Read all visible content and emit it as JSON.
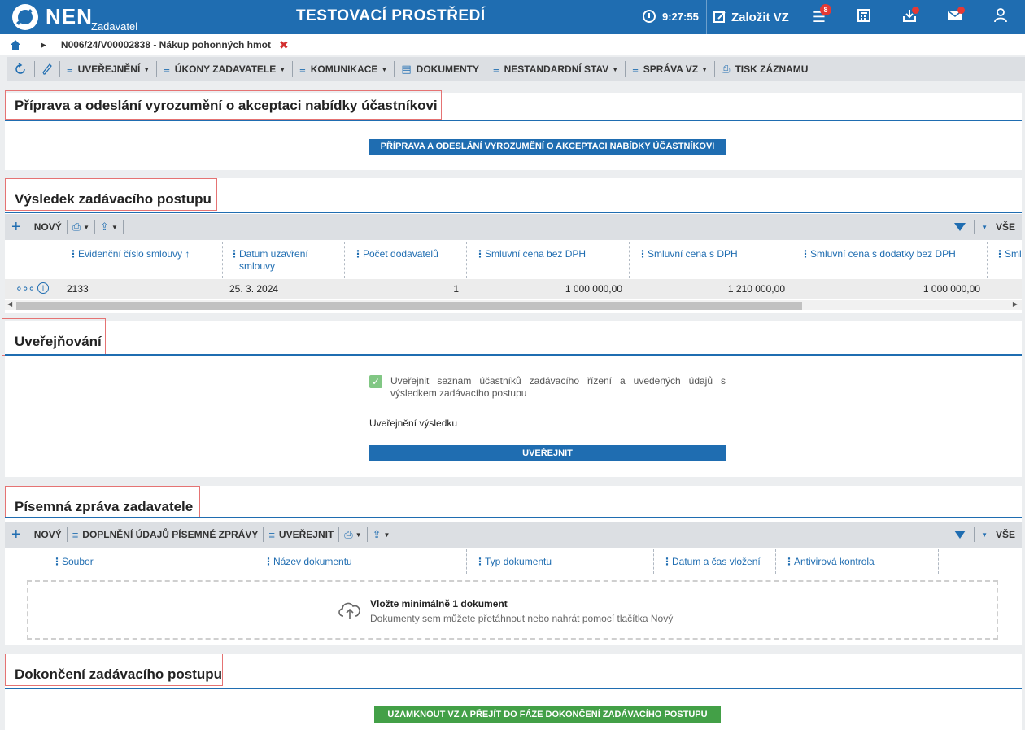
{
  "header": {
    "logo": "NEN",
    "logo_sub": "Zadavatel",
    "env_title": "TESTOVACÍ PROSTŘEDÍ",
    "clock": "9:27:55",
    "create_vz": "Založit VZ",
    "menu_badge": "8"
  },
  "breadcrumb": {
    "text": "N006/24/V00002838 - Nákup pohonných hmot"
  },
  "toolbar": {
    "uverejneni": "UVEŘEJNĚNÍ",
    "ukony": "ÚKONY ZADAVATELE",
    "komunikace": "KOMUNIKACE",
    "dokumenty": "DOKUMENTY",
    "nestandardni": "NESTANDARDNÍ STAV",
    "sprava": "SPRÁVA VZ",
    "tisk": "TISK ZÁZNAMU"
  },
  "section1": {
    "title": "Příprava a odeslání vyrozumění o akceptaci nabídky účastníkovi",
    "button": "PŘÍPRAVA A ODESLÁNÍ VYROZUMĚNÍ O AKCEPTACI NABÍDKY ÚČASTNÍKOVI"
  },
  "section2": {
    "title": "Výsledek zadávacího postupu",
    "new_label": "NOVÝ",
    "all_label": "VŠE",
    "columns": [
      "Evidenční číslo smlouvy ↑",
      "Datum uzavření smlouvy",
      "Počet dodavatelů",
      "Smluvní cena bez DPH",
      "Smluvní cena s DPH",
      "Smluvní cena s dodatky bez DPH",
      "Sml"
    ],
    "row": {
      "ev_cislo": "2133",
      "datum": "25. 3. 2024",
      "pocet": "1",
      "cena_bez": "1 000 000,00",
      "cena_s": "1 210 000,00",
      "cena_dodatky": "1 000 000,00"
    }
  },
  "section3": {
    "title": "Uveřejňování",
    "checkbox_label": "Uveřejnit seznam účastníků zadávacího řízení a uvedených údajů s výsledkem zadávacího postupu",
    "checkbox_checked": true,
    "result_label": "Uveřejnění výsledku",
    "button": "UVEŘEJNIT"
  },
  "section4": {
    "title": "Písemná zpráva zadavatele",
    "new_label": "NOVÝ",
    "doplneni": "DOPLNĚNÍ ÚDAJŮ PÍSEMNÉ ZPRÁVY",
    "uverejnit": "UVEŘEJNIT",
    "all_label": "VŠE",
    "columns": [
      "Soubor",
      "Název dokumentu",
      "Typ dokumentu",
      "Datum a čas vložení",
      "Antivirová kontrola"
    ],
    "upload_title": "Vložte minimálně 1 dokument",
    "upload_hint": "Dokumenty sem můžete přetáhnout nebo nahrát pomocí tlačítka Nový"
  },
  "section5": {
    "title": "Dokončení zadávacího postupu",
    "button": "UZAMKNOUT VZ A PŘEJÍT DO FÁZE DOKONČENÍ ZADÁVACÍHO POSTUPU"
  }
}
